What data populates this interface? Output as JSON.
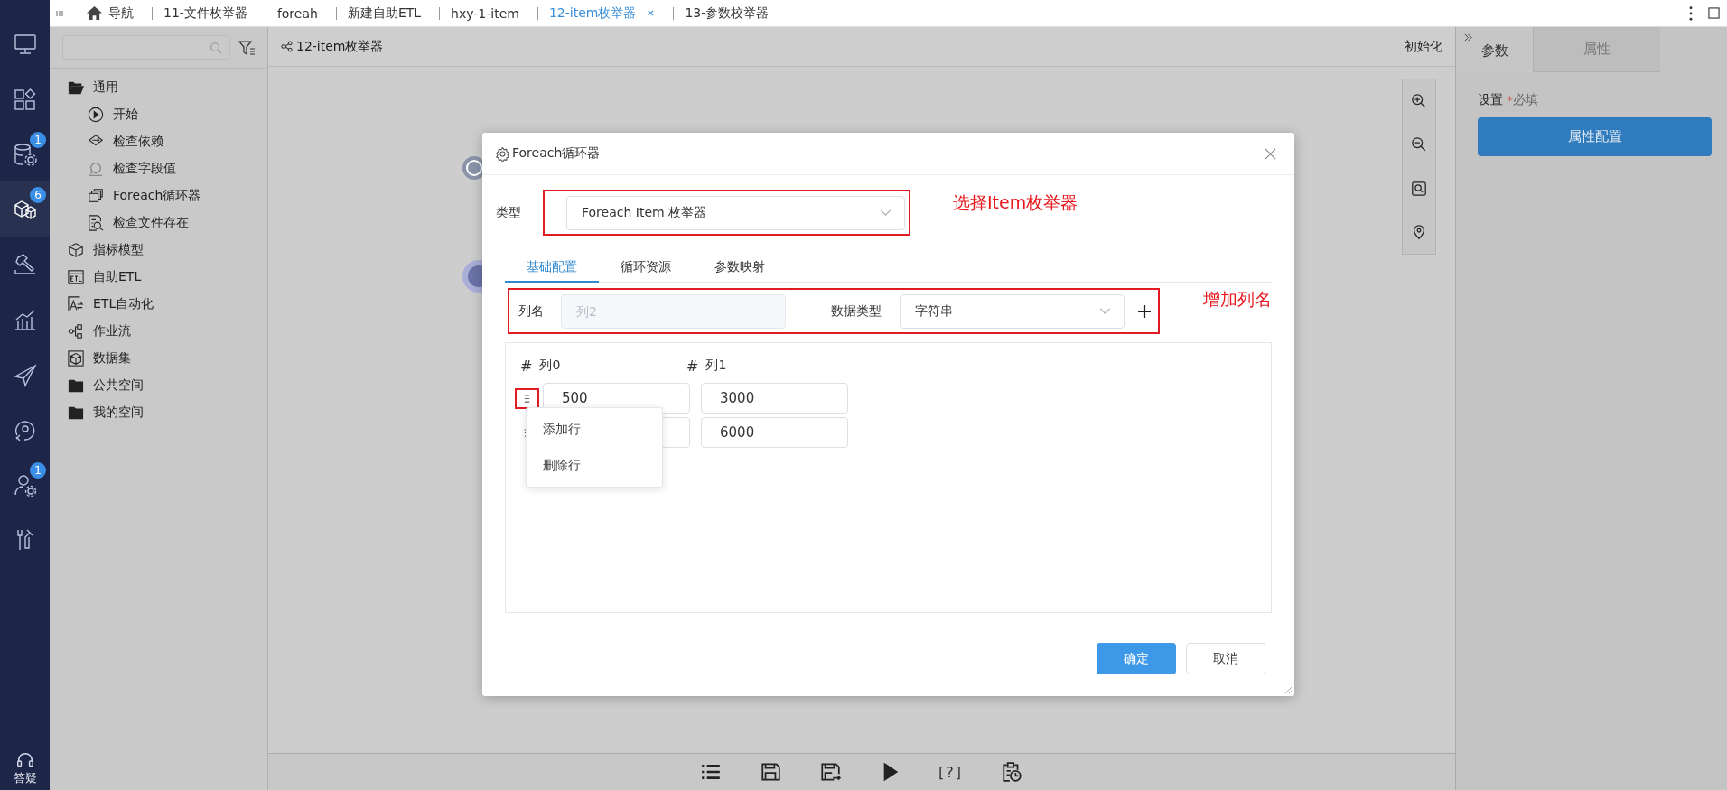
{
  "nav": {
    "items": [
      {
        "kind": "monitor",
        "selected": false
      },
      {
        "kind": "apps",
        "selected": false
      },
      {
        "kind": "database",
        "selected": false,
        "badge": "1"
      },
      {
        "kind": "cubes",
        "selected": true,
        "badge": "6"
      },
      {
        "kind": "hammer",
        "selected": false
      },
      {
        "kind": "chart",
        "selected": false
      },
      {
        "kind": "plane",
        "selected": false
      },
      {
        "kind": "analysis",
        "selected": false
      },
      {
        "kind": "user",
        "selected": false,
        "badge": "1"
      },
      {
        "kind": "tools",
        "selected": false
      }
    ],
    "help_label": "答疑"
  },
  "tabs": [
    {
      "kind": "home",
      "label": "导航",
      "selected": false
    },
    {
      "kind": "page",
      "label": "11-文件枚举器",
      "selected": false
    },
    {
      "kind": "page",
      "label": "foreah",
      "selected": false
    },
    {
      "kind": "page",
      "label": "新建自助ETL",
      "selected": false
    },
    {
      "kind": "page",
      "label": "hxy-1-item",
      "selected": false
    },
    {
      "kind": "page",
      "label": "12-item枚举器",
      "selected": true
    },
    {
      "kind": "page",
      "label": "13-参数校举器",
      "selected": false
    }
  ],
  "tree": {
    "items": [
      {
        "kind": "folder",
        "label": "通用",
        "expanded": true,
        "children": [
          {
            "kind": "start",
            "label": "开始"
          },
          {
            "kind": "dependency",
            "label": "检查依赖"
          },
          {
            "kind": "field",
            "label": "检查字段值"
          },
          {
            "kind": "loop",
            "label": "Foreach循环器"
          },
          {
            "kind": "file",
            "label": "检查文件存在"
          }
        ]
      },
      {
        "kind": "model",
        "label": "指标模型"
      },
      {
        "kind": "etl",
        "label": "自助ETL"
      },
      {
        "kind": "auto",
        "label": "ETL自动化"
      },
      {
        "kind": "flow",
        "label": "作业流"
      },
      {
        "kind": "dataset",
        "label": "数据集"
      },
      {
        "kind": "folder",
        "label": "公共空间",
        "expanded": false
      },
      {
        "kind": "folder",
        "label": "我的空间",
        "expanded": false
      }
    ]
  },
  "canvas": {
    "title": "12-item枚举器",
    "init_label": "初始化"
  },
  "toolbar": [
    {
      "kind": "list"
    },
    {
      "kind": "save"
    },
    {
      "kind": "save-as"
    },
    {
      "kind": "run"
    },
    {
      "kind": "help",
      "label": "[?]"
    },
    {
      "kind": "schedule"
    }
  ],
  "right_panel": {
    "tabs": [
      {
        "label": "参数",
        "selected": true
      },
      {
        "label": "属性",
        "selected": false
      }
    ],
    "settings_label": "设置",
    "required_mark": "*",
    "required_text": "必填",
    "config_button": "属性配置"
  },
  "dialog": {
    "title": "Foreach循环器",
    "type_label": "类型",
    "type_value": "Foreach Item 枚举器",
    "type_note": "选择Item枚举器",
    "tabs": [
      {
        "label": "基础配置",
        "selected": true
      },
      {
        "label": "循环资源",
        "selected": false
      },
      {
        "label": "参数映射",
        "selected": false
      }
    ],
    "column_name_label": "列名",
    "column_name_placeholder": "列2",
    "data_type_label": "数据类型",
    "data_type_value": "字符串",
    "column_note": "增加列名",
    "columns": [
      {
        "type_glyph": "#",
        "name": "列0"
      },
      {
        "type_glyph": "#",
        "name": "列1"
      }
    ],
    "rows": [
      {
        "highlighted": true,
        "cells": [
          "500",
          "3000"
        ]
      },
      {
        "highlighted": false,
        "cells": [
          null,
          "6000"
        ]
      }
    ],
    "row_menu": [
      "添加行",
      "删除行"
    ],
    "buttons": [
      {
        "kind": "primary",
        "label": "确定"
      },
      {
        "kind": "default",
        "label": "取消"
      }
    ]
  }
}
